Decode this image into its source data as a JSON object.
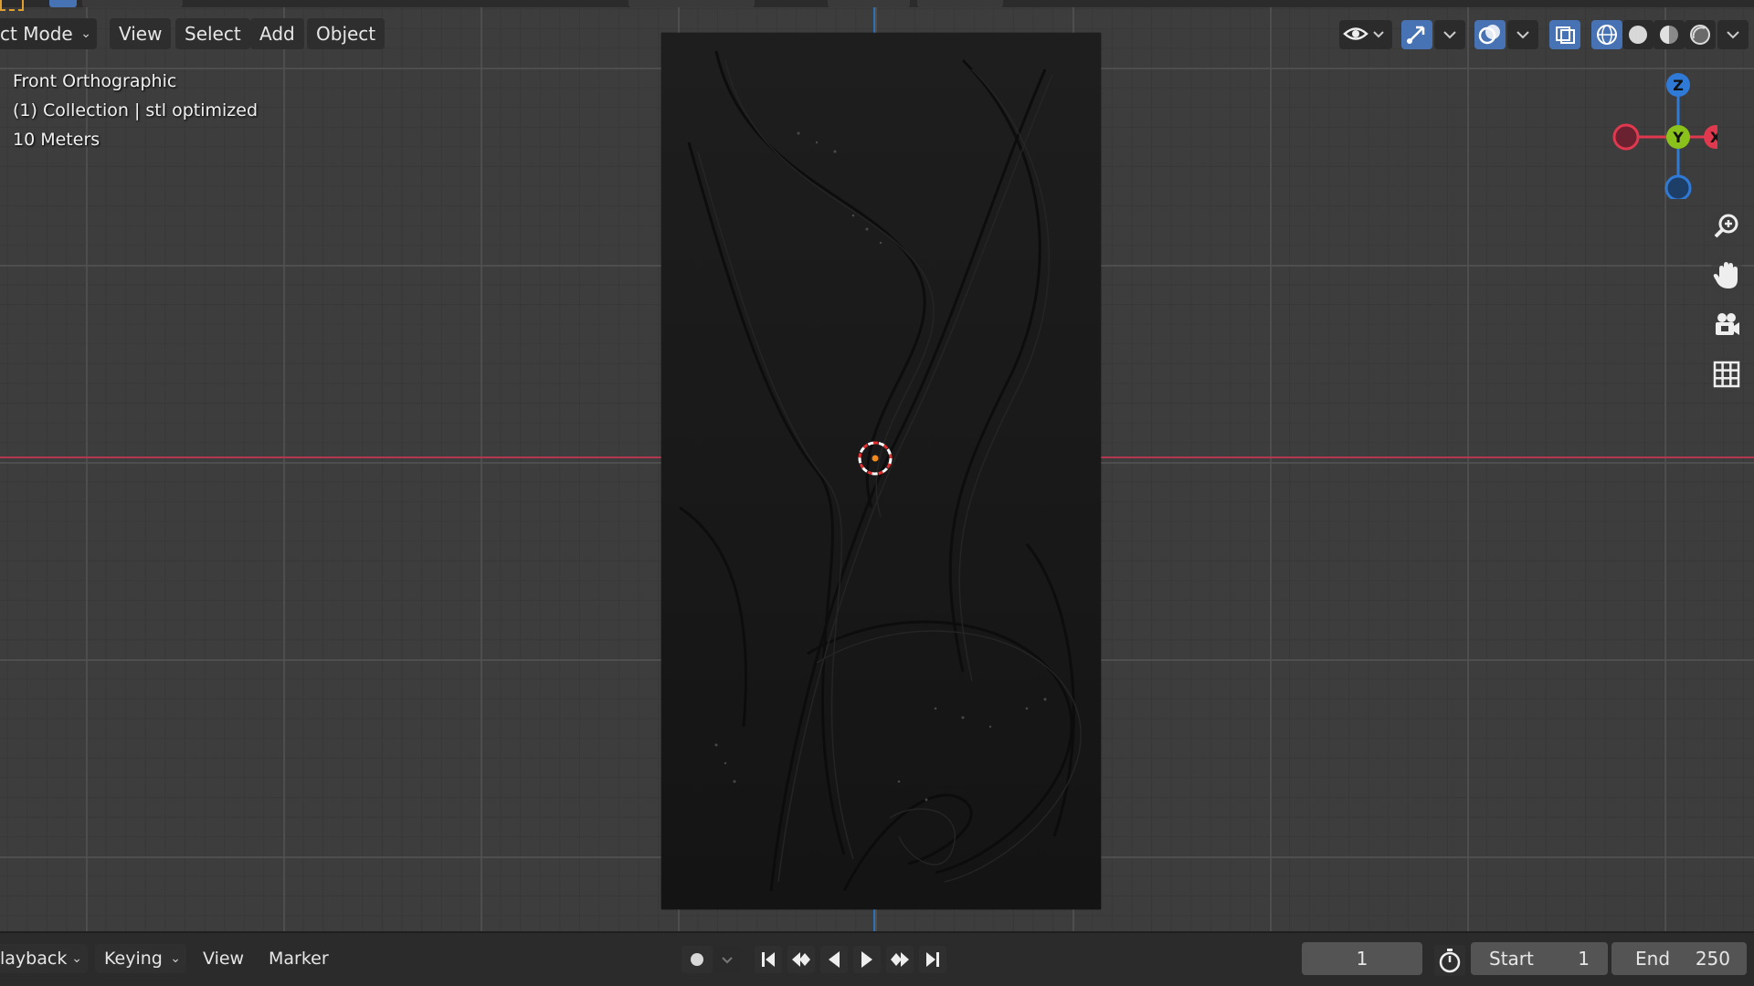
{
  "header": {
    "mode_label": "ct Mode",
    "menus": [
      "View",
      "Select",
      "Add",
      "Object"
    ]
  },
  "overlay": {
    "view_name": "Front Orthographic",
    "collection": "(1) Collection | stl optimized",
    "scale": "10 Meters"
  },
  "gizmo": {
    "z_label": "Z",
    "y_label": "Y",
    "x_label": "X"
  },
  "timeline": {
    "playback_label": "layback",
    "keying_label": "Keying",
    "view_label": "View",
    "marker_label": "Marker",
    "current_frame": "1",
    "start_label": "Start",
    "start_value": "1",
    "end_label": "End",
    "end_value": "250"
  },
  "icons": {
    "nav": [
      "zoom-icon",
      "hand-pan-icon",
      "camera-icon",
      "grid-icon"
    ],
    "playback": [
      "jump-start-icon",
      "prev-keyframe-icon",
      "play-reverse-icon",
      "play-icon",
      "next-keyframe-icon",
      "jump-end-icon"
    ]
  },
  "colors": {
    "axis_x": "#b3364f",
    "axis_z": "#2f6fb5",
    "gizmo_x": "#e0394f",
    "gizmo_y": "#8bc11b",
    "gizmo_z": "#2f7ad6",
    "accent": "#4772b3"
  }
}
